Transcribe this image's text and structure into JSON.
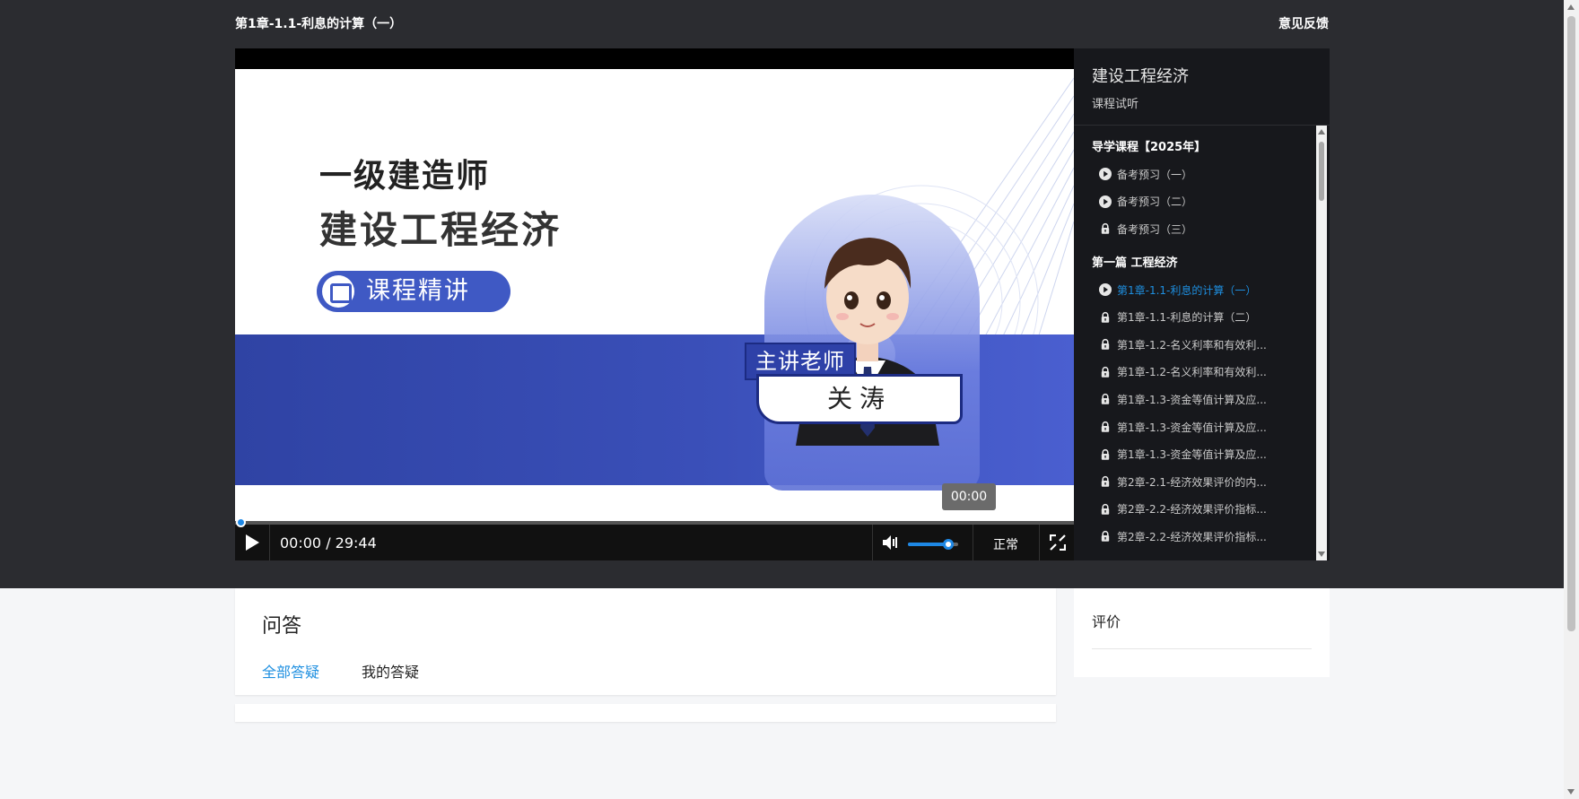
{
  "header": {
    "lesson_title": "第1章-1.1-利息的计算（一）",
    "feedback": "意见反馈"
  },
  "player": {
    "slide": {
      "title_line1": "一级建造师",
      "title_line2": "建设工程经济",
      "badge": "课程精讲",
      "teacher_label": "主讲老师",
      "teacher_name": "关涛"
    },
    "hover_time": "00:00",
    "timecode": "00:00 / 29:44",
    "progress_fraction": 0,
    "volume_fraction": 0.8,
    "speed_label": "正常",
    "accent_color": "#1e88e5"
  },
  "sidebar": {
    "course_name": "建设工程经济",
    "course_sub": "课程试听",
    "sections": [
      {
        "title": "导学课程【2025年】",
        "items": [
          {
            "label": "备考预习（一）",
            "icon": "play-icon"
          },
          {
            "label": "备考预习（二）",
            "icon": "play-icon"
          },
          {
            "label": "备考预习（三）",
            "icon": "lock-icon"
          }
        ]
      },
      {
        "title": "第一篇 工程经济",
        "items": [
          {
            "label": "第1章-1.1-利息的计算（一）",
            "icon": "play-icon",
            "active": true
          },
          {
            "label": "第1章-1.1-利息的计算（二）",
            "icon": "lock-icon"
          },
          {
            "label": "第1章-1.2-名义利率和有效利...",
            "icon": "lock-icon"
          },
          {
            "label": "第1章-1.2-名义利率和有效利...",
            "icon": "lock-icon"
          },
          {
            "label": "第1章-1.3-资金等值计算及应...",
            "icon": "lock-icon"
          },
          {
            "label": "第1章-1.3-资金等值计算及应...",
            "icon": "lock-icon"
          },
          {
            "label": "第1章-1.3-资金等值计算及应...",
            "icon": "lock-icon"
          },
          {
            "label": "第2章-2.1-经济效果评价的内...",
            "icon": "lock-icon"
          },
          {
            "label": "第2章-2.2-经济效果评价指标...",
            "icon": "lock-icon"
          },
          {
            "label": "第2章-2.2-经济效果评价指标...",
            "icon": "lock-icon"
          }
        ]
      }
    ]
  },
  "qa": {
    "title": "问答",
    "tabs": [
      {
        "label": "全部答疑",
        "active": true
      },
      {
        "label": "我的答疑",
        "active": false
      }
    ]
  },
  "rating": {
    "title": "评价"
  }
}
